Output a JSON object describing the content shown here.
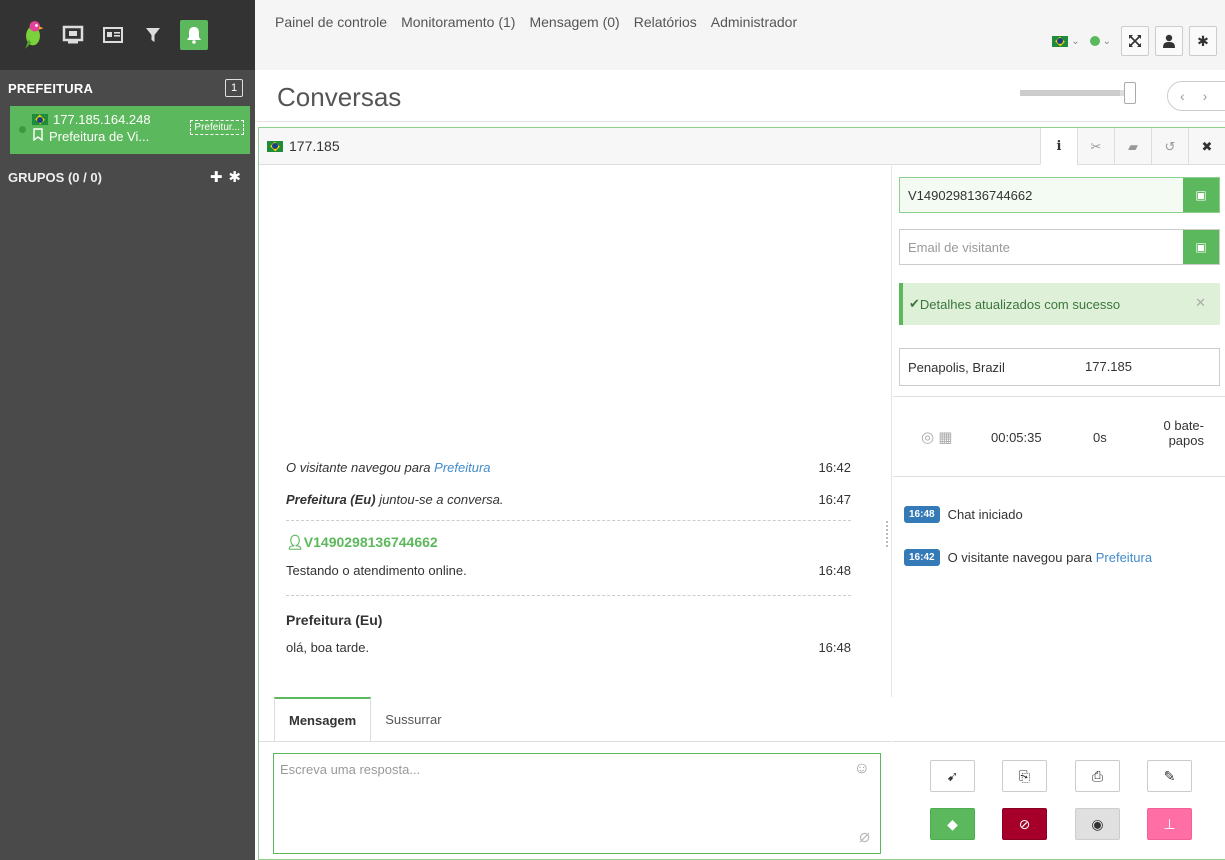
{
  "nav": {
    "items": [
      {
        "label": "Painel de controle"
      },
      {
        "label": "Monitoramento (1)"
      },
      {
        "label": "Mensagem (0)"
      },
      {
        "label": "Relatórios"
      },
      {
        "label": "Administrador"
      }
    ]
  },
  "sidebar": {
    "department_title": "PREFEITURA",
    "department_count": "1",
    "chat": {
      "ip": "177.185.164.248",
      "department": "Prefeitura de Vi...",
      "tag": "Prefeitur..."
    },
    "groups_title": "GRUPOS (0 / 0)"
  },
  "page": {
    "title": "Conversas"
  },
  "chat": {
    "tab_title": "177.185",
    "messages": {
      "sys1_text": "O visitante navegou para ",
      "sys1_link": "Prefeitura",
      "sys1_time": "16:42",
      "sys2_author": "Prefeitura (Eu)",
      "sys2_text": " juntou-se a conversa.",
      "sys2_time": "16:47",
      "visitor_name": "V1490298136744662",
      "visitor_text": "Testando o atendimento online.",
      "visitor_time": "16:48",
      "operator_name": "Prefeitura (Eu)",
      "operator_text": "olá, boa tarde.",
      "operator_time": "16:48"
    },
    "compose_tabs": {
      "message": "Mensagem",
      "whisper": "Sussurrar"
    },
    "compose_placeholder": "Escreva uma resposta..."
  },
  "info": {
    "nick_value": "V1490298136744662",
    "email_placeholder": "Email de visitante",
    "alert_text": "Detalhes atualizados com sucesso",
    "location": "Penapolis, Brazil",
    "ip": "177.185",
    "duration": "00:05:35",
    "wait": "0s",
    "chats_line1": "0 bate-",
    "chats_line2": "papos",
    "events": [
      {
        "time": "16:48",
        "text": "Chat iniciado",
        "link": ""
      },
      {
        "time": "16:42",
        "text": "O visitante navegou para ",
        "link": "Prefeitura"
      }
    ]
  },
  "colors": {
    "accent": "#5cb85c",
    "sidebar": "#4a4a4a",
    "badge": "#337ab7",
    "block": "#a6002a",
    "pin": "#ff6fa5"
  },
  "icons": [
    "parrot-logo-icon",
    "monitor-icon",
    "card-icon",
    "filter-icon",
    "bell-icon",
    "flag-brazil-icon",
    "bookmark-icon",
    "plus-icon",
    "gear-icon",
    "expand-icon",
    "user-icon",
    "info-icon",
    "scissors-icon",
    "book-icon",
    "history-icon",
    "close-icon",
    "save-icon",
    "check-icon",
    "chrome-icon",
    "windows-icon",
    "smile-icon",
    "paperclip-icon",
    "transfer-icon",
    "copy-icon",
    "print-icon",
    "edit-icon",
    "tag-icon",
    "block-icon",
    "hide-icon",
    "pin-icon"
  ]
}
